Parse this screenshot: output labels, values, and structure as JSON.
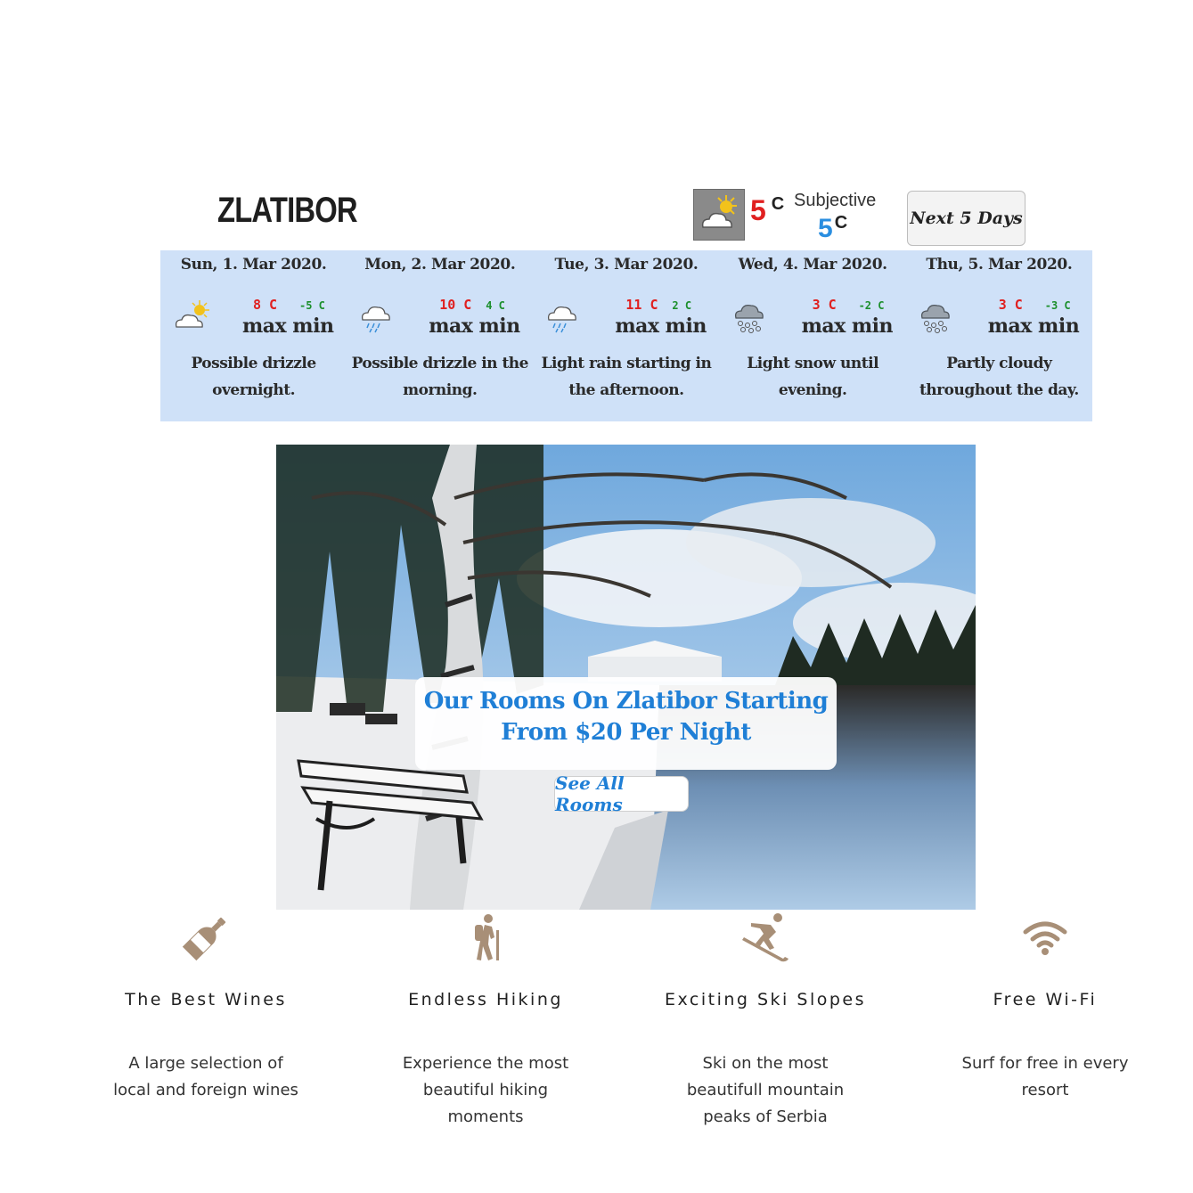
{
  "header": {
    "location": "ZLATIBOR",
    "current_temp": "5",
    "current_unit": "C",
    "subjective_label": "Subjective",
    "subjective_temp": "5",
    "subjective_unit": "C",
    "next_button": "Next 5 Days",
    "current_icon": "partly-cloudy-icon"
  },
  "forecast": [
    {
      "date": "Sun, 1. Mar 2020.",
      "max": "8 C",
      "min": "-5 C",
      "maxmin_label": "max min",
      "desc": "Possible drizzle overnight.",
      "icon": "partly-cloudy-icon"
    },
    {
      "date": "Mon, 2. Mar 2020.",
      "max": "10 C",
      "min": "4 C",
      "maxmin_label": "max min",
      "desc": "Possible drizzle in the morning.",
      "icon": "rain-icon"
    },
    {
      "date": "Tue, 3. Mar 2020.",
      "max": "11 C",
      "min": "2 C",
      "maxmin_label": "max min",
      "desc": "Light rain starting in the afternoon.",
      "icon": "rain-icon"
    },
    {
      "date": "Wed, 4. Mar 2020.",
      "max": "3 C",
      "min": "-2 C",
      "maxmin_label": "max min",
      "desc": "Light snow until evening.",
      "icon": "snow-icon"
    },
    {
      "date": "Thu, 5. Mar 2020.",
      "max": "3 C",
      "min": "-3 C",
      "maxmin_label": "max min",
      "desc": "Partly cloudy throughout the day.",
      "icon": "snow-icon"
    }
  ],
  "hero": {
    "banner_line1": "Our Rooms On Zlatibor Starting",
    "banner_line2": "From $20 Per Night",
    "button": "See All Rooms"
  },
  "features": [
    {
      "title": "The Best Wines",
      "text": "A large selection of local and foreign wines",
      "icon": "wine-bottle-icon"
    },
    {
      "title": "Endless Hiking",
      "text": "Experience the most beautiful hiking moments",
      "icon": "hiking-icon"
    },
    {
      "title": "Exciting Ski Slopes",
      "text": "Ski on the most beautifull mountain peaks of Serbia",
      "icon": "skiing-icon"
    },
    {
      "title": "Free Wi-Fi",
      "text": "Surf for free in every resort",
      "icon": "wifi-icon"
    }
  ],
  "colors": {
    "forecast_bg": "#cfe1f8",
    "max_temp": "#e02020",
    "min_temp": "#1c8f2c",
    "accent_blue": "#1f7fd6",
    "feature_icon": "#a88f77"
  }
}
